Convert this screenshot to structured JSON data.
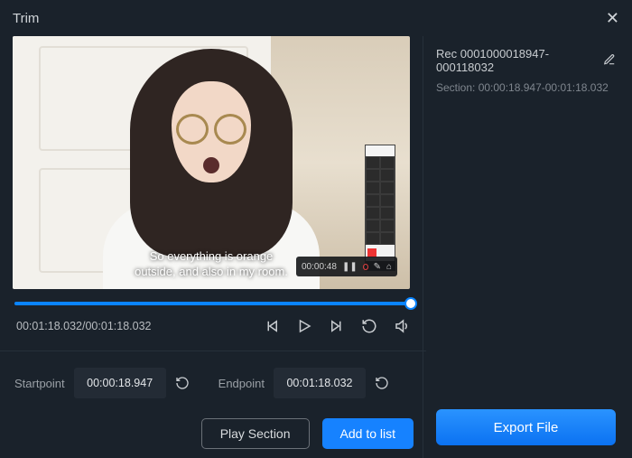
{
  "title": "Trim",
  "video": {
    "caption_line1": "So everything is orange",
    "caption_line2": "outside, and also in my room.",
    "rec_time": "00:00:48"
  },
  "playback": {
    "current": "00:01:18.032",
    "total": "00:01:18.032"
  },
  "trim": {
    "start_label": "Startpoint",
    "start_value": "00:00:18.947",
    "end_label": "Endpoint",
    "end_value": "00:01:18.032"
  },
  "buttons": {
    "play_section": "Play Section",
    "add_to_list": "Add to list",
    "export": "Export File"
  },
  "side": {
    "rec_name": "Rec 0001000018947-000118032",
    "section_label": "Section: 00:00:18.947-00:01:18.032"
  }
}
